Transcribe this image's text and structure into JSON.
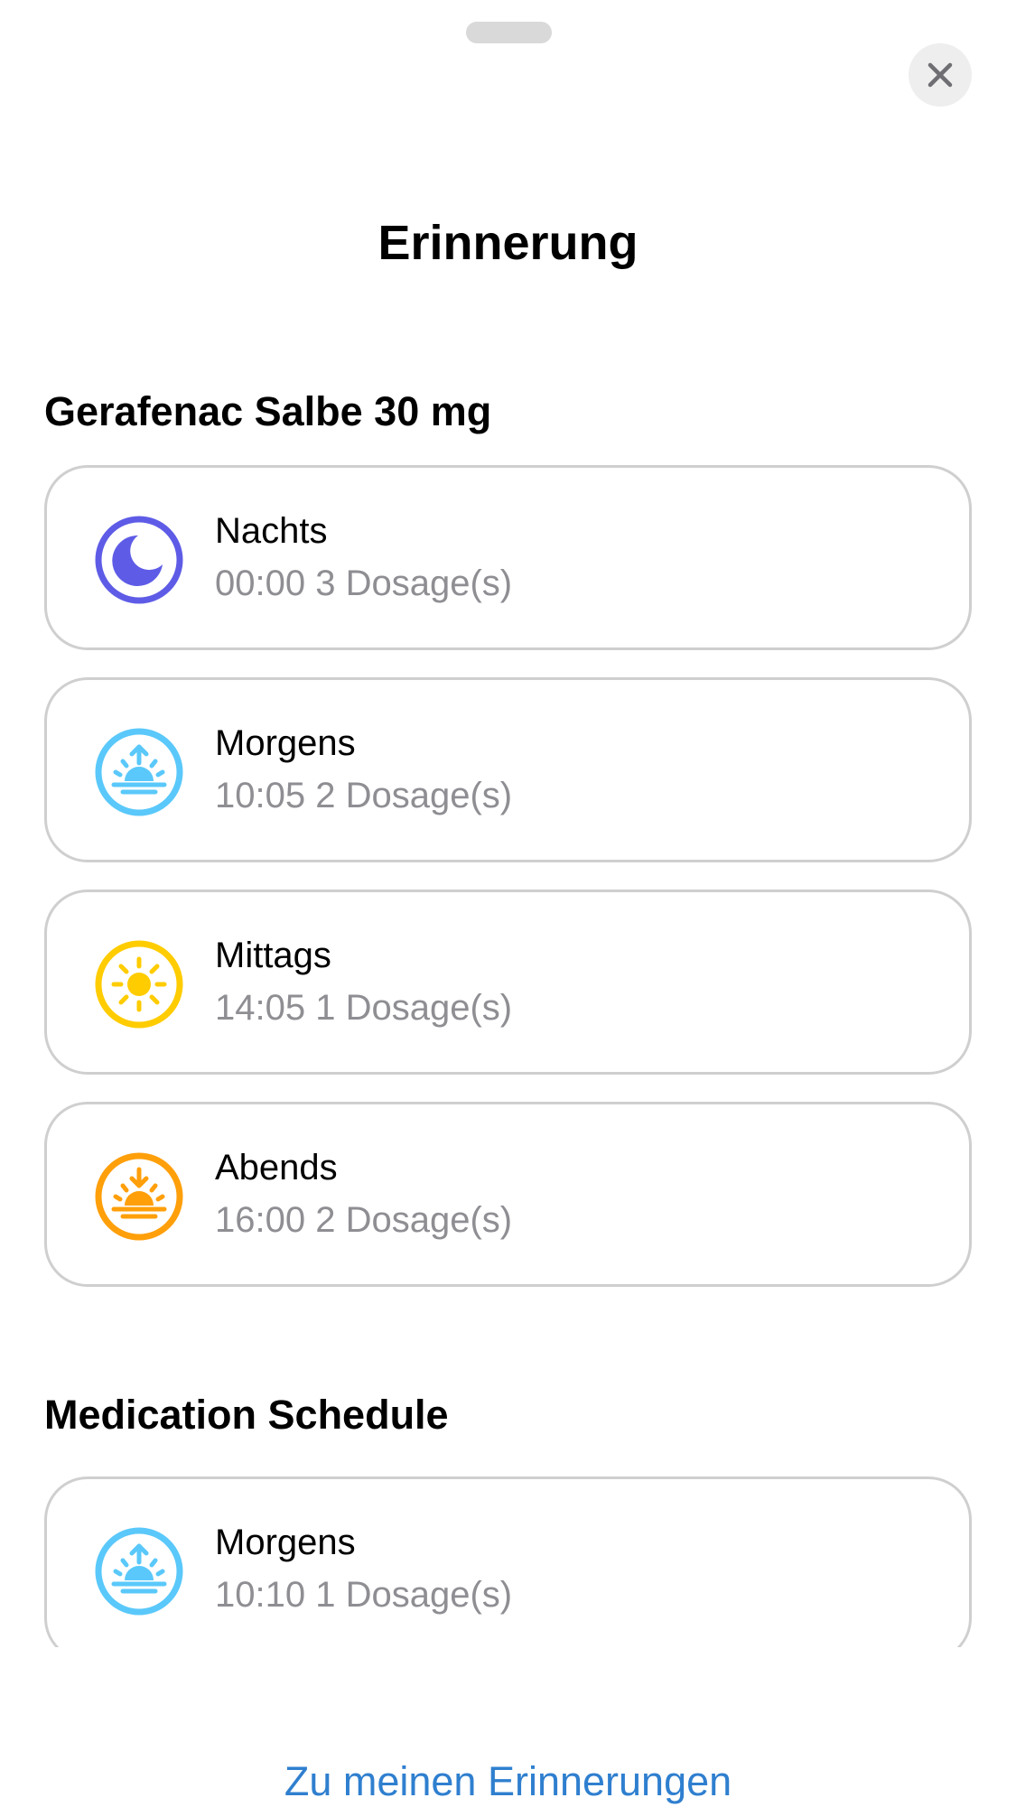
{
  "sheet": {
    "title": "Erinnerung",
    "close_icon": "close-icon",
    "footer_link": "Zu meinen Erinnerungen"
  },
  "sections": [
    {
      "title": "Gerafenac Salbe 30 mg",
      "items": [
        {
          "label": "Nachts",
          "detail": "00:00 3 Dosage(s)",
          "icon": "moon-icon",
          "color": "#5E5CE6"
        },
        {
          "label": "Morgens",
          "detail": "10:05 2 Dosage(s)",
          "icon": "sunrise-icon",
          "color": "#5AC8FA"
        },
        {
          "label": "Mittags",
          "detail": "14:05 1 Dosage(s)",
          "icon": "sun-icon",
          "color": "#FFCC00"
        },
        {
          "label": "Abends",
          "detail": "16:00 2 Dosage(s)",
          "icon": "sunset-icon",
          "color": "#FF9F0A"
        }
      ]
    },
    {
      "title": "Medication Schedule",
      "items": [
        {
          "label": "Morgens",
          "detail": "10:10 1 Dosage(s)",
          "icon": "sunrise-icon",
          "color": "#5AC8FA"
        }
      ]
    }
  ],
  "colors": {
    "link": "#2F7FCF",
    "secondary_text": "#8E8E93",
    "card_border": "#CFCFCF"
  }
}
